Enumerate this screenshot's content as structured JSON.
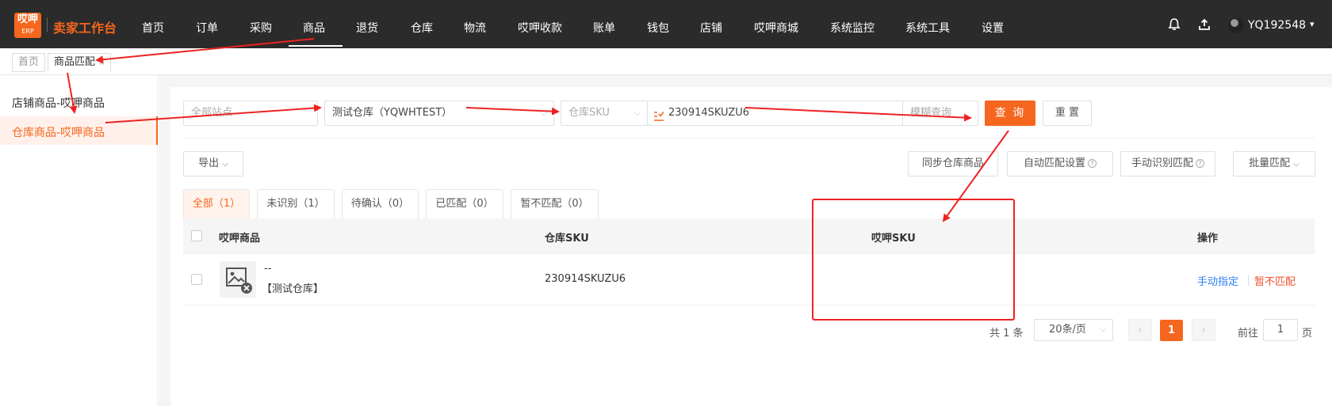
{
  "brand": {
    "logo_line1": "哎呷",
    "logo_line2": "ERP",
    "title": "卖家工作台"
  },
  "nav": {
    "items": [
      "首页",
      "订单",
      "采购",
      "商品",
      "退货",
      "仓库",
      "物流",
      "哎呷收款",
      "账单",
      "钱包",
      "店铺",
      "哎呷商城",
      "系统监控",
      "系统工具",
      "设置"
    ],
    "active": "商品"
  },
  "user": {
    "name": "YQ192548"
  },
  "page_tabs": {
    "home": "首页",
    "current": "商品匹配",
    "close": "×"
  },
  "sidebar": {
    "items": [
      "店铺商品-哎呷商品",
      "仓库商品-哎呷商品"
    ],
    "active_index": 1
  },
  "filters": {
    "site_placeholder": "全部站点",
    "warehouse_value": "测试仓库（YQWHTEST）",
    "sku_type": "仓库SKU",
    "sku_value": "230914SKUZU6",
    "match_mode": "模糊查询",
    "search_label": "查 询",
    "reset_label": "重 置"
  },
  "toolbar": {
    "export_label": "导出",
    "sync_label": "同步仓库商品",
    "auto_match_label": "自动匹配设置",
    "manual_identify_label": "手动识别匹配",
    "batch_match_label": "批量匹配"
  },
  "status_tabs": [
    "全部（1）",
    "未识别（1）",
    "待确认（0）",
    "已匹配（0）",
    "暂不匹配（0）"
  ],
  "table": {
    "headers": [
      "哎呷商品",
      "仓库SKU",
      "哎呷SKU",
      "操作"
    ],
    "rows": [
      {
        "product_name": "--",
        "warehouse_name": "【测试仓库】",
        "warehouse_sku": "230914SKUZU6",
        "aiya_sku": "",
        "op_assign": "手动指定",
        "op_skip": "暂不匹配"
      }
    ]
  },
  "pagination": {
    "total": "共 1 条",
    "page_size": "20条/页",
    "current_page": "1",
    "goto_label": "前往",
    "goto_value": "1",
    "page_suffix": "页"
  },
  "colors": {
    "accent": "#f5661e",
    "nav_bg": "#2b2b2b",
    "annotation": "#ee2222",
    "link_blue": "#2d7ff9"
  }
}
